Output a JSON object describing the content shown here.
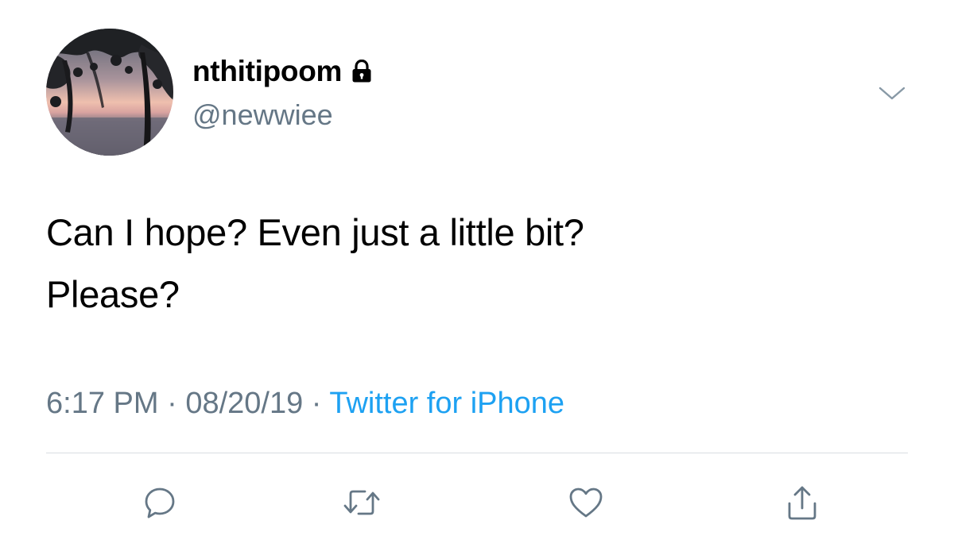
{
  "tweet": {
    "avatar_icon": "profile-photo-sunset-trees",
    "display_name": "nthitipoom",
    "protected_icon": "lock-icon",
    "handle": "@newwiee",
    "menu_icon": "chevron-down-icon",
    "text_lines": [
      "Can I hope? Even just a little bit?",
      "Please?"
    ],
    "time": "6:17 PM",
    "separator": "·",
    "date": "08/20/19",
    "source": "Twitter for iPhone"
  },
  "actions": {
    "reply_icon": "reply-icon",
    "retweet_icon": "retweet-icon",
    "like_icon": "heart-icon",
    "share_icon": "share-icon"
  },
  "colors": {
    "text": "#000000",
    "secondary": "#657786",
    "link": "#1da1f2",
    "divider": "#d8dde1"
  }
}
